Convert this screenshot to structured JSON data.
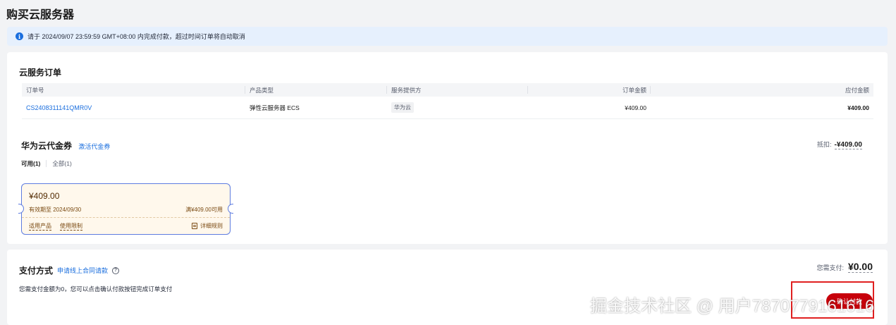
{
  "page": {
    "title": "购买云服务器"
  },
  "notice": {
    "text": "请于 2024/09/07 23:59:59 GMT+08:00 内完成付款，超过时间订单将自动取消"
  },
  "order": {
    "title": "云服务订单",
    "columns": [
      "订单号",
      "产品类型",
      "服务提供方",
      "订单金额",
      "应付金额"
    ],
    "row": {
      "order_no": "CS2408311141QMR0V",
      "product_type": "弹性云服务器 ECS",
      "provider": "华为云",
      "order_amount": "¥409.00",
      "payable": "¥409.00"
    }
  },
  "voucher": {
    "title": "华为云代金券",
    "activate_link": "激活代金券",
    "deduct_label": "抵扣:",
    "deduct_amount": "-¥409.00",
    "tabs": [
      "可用(1)",
      "全部(1)"
    ],
    "coupon": {
      "amount": "¥409.00",
      "expire": "有效期至 2024/09/30",
      "condition": "满¥409.00可用",
      "links": [
        "适用产品",
        "使用限制"
      ],
      "rule": "详细规则"
    }
  },
  "payment": {
    "title": "支付方式",
    "apply_link": "申请线上合同请款",
    "desc": "您需支付金额为0，您可以点击确认付款按钮完成订单支付",
    "need_pay_label": "您需支付:",
    "need_pay_amount": "¥0.00",
    "confirm_label": "确认付款"
  },
  "watermark": "掘金技术社区 @ 用户7870779161616"
}
